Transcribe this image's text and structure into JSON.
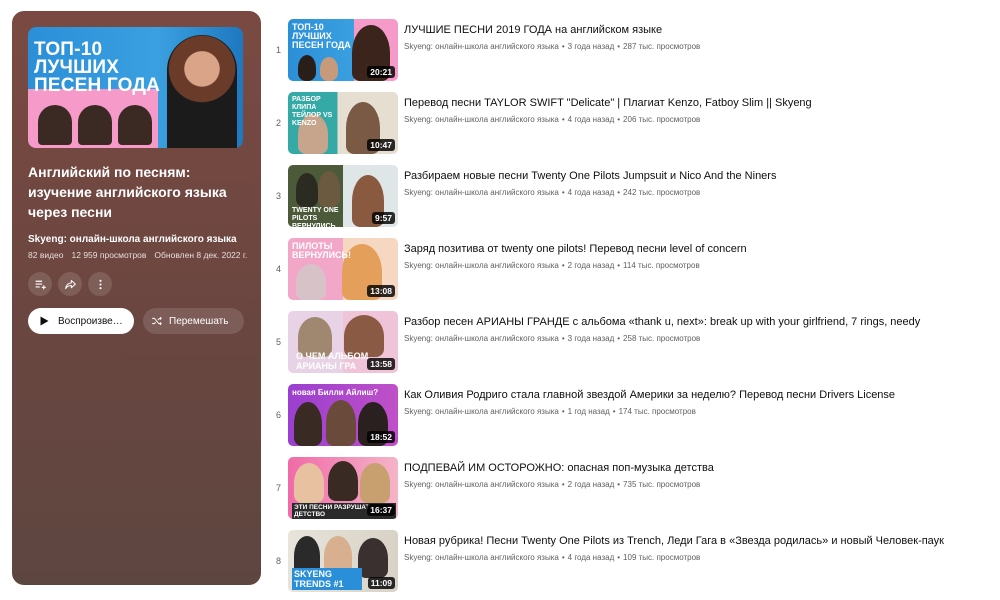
{
  "playlist": {
    "cover_title": "ТОП-10 ЛУЧШИХ ПЕСЕН ГОДА",
    "title": "Английский по песням: изучение английского языка через песни",
    "channel": "Skyeng: онлайн-школа английского языка",
    "video_count": "82 видео",
    "views": "12 959 просмотров",
    "updated": "Обновлен 8 дек. 2022 г.",
    "play_label": "Воспроизве…",
    "shuffle_label": "Перемешать",
    "panel_color": "#6e4842"
  },
  "videos": [
    {
      "index": "1",
      "title": "ЛУЧШИЕ ПЕСНИ 2019 ГОДА на английском языке",
      "channel": "Skyeng: онлайн-школа английского языка",
      "age": "3 года назад",
      "views": "287 тыс. просмотров",
      "duration": "20:21",
      "caption": "ТОП-10 ЛУЧШИХ ПЕСЕН ГОДА"
    },
    {
      "index": "2",
      "title": "Перевод песни TAYLOR SWIFT \"Delicate\" | Плагиат Kenzo, Fatboy Slim || Skyeng",
      "channel": "Skyeng: онлайн-школа английского языка",
      "age": "4 года назад",
      "views": "206 тыс. просмотров",
      "duration": "10:47",
      "caption": "РАЗБОР КЛИПА ТЕЙЛОР VS KENZO"
    },
    {
      "index": "3",
      "title": "Разбираем новые песни Twenty One Pilots Jumpsuit и Nico And the Niners",
      "channel": "Skyeng: онлайн-школа английского языка",
      "age": "4 года назад",
      "views": "242 тыс. просмотров",
      "duration": "9:57",
      "caption": "TWENTY ONE PILOTS ВЕРНУЛИСЬ"
    },
    {
      "index": "4",
      "title": "Заряд позитива от twenty one pilots! Перевод песни level of concern",
      "channel": "Skyeng: онлайн-школа английского языка",
      "age": "2 года назад",
      "views": "114 тыс. просмотров",
      "duration": "13:08",
      "caption": "ПИЛОТЫ ВЕРНУЛИСЬ!"
    },
    {
      "index": "5",
      "title": "Разбор песен АРИАНЫ ГРАНДЕ с альбома «thank u, next»: break up with your girlfriend, 7 rings, needy",
      "channel": "Skyeng: онлайн-школа английского языка",
      "age": "3 года назад",
      "views": "258 тыс. просмотров",
      "duration": "13:58",
      "caption": "О ЧЕМ АЛЬБОМ АРИАНЫ ГРА"
    },
    {
      "index": "6",
      "title": "Как Оливия Родриго стала главной звездой Америки за неделю? Перевод песни Drivers License",
      "channel": "Skyeng: онлайн-школа английского языка",
      "age": "1 год назад",
      "views": "174 тыс. просмотров",
      "duration": "18:52",
      "caption": "новая Билли Айлиш?"
    },
    {
      "index": "7",
      "title": "ПОДПЕВАЙ ИМ ОСТОРОЖНО: опасная поп-музыка детства",
      "channel": "Skyeng: онлайн-школа английского языка",
      "age": "2 года назад",
      "views": "735 тыс. просмотров",
      "duration": "16:37",
      "caption": "ЭТИ ПЕСНИ РАЗРУШАТ ДЕТСТВО"
    },
    {
      "index": "8",
      "title": "Новая рубрика! Песни Twenty One Pilots из Trench, Леди Гага в «Звезда родилась» и новый Человек-паук",
      "channel": "Skyeng: онлайн-школа английского языка",
      "age": "4 года назад",
      "views": "109 тыс. просмотров",
      "duration": "11:09",
      "caption": "SKYENG TRENDS #1"
    }
  ],
  "icons": {
    "save": "playlist-add-icon",
    "share": "share-icon",
    "more": "more-vertical-icon",
    "play": "play-icon",
    "shuffle": "shuffle-icon"
  }
}
